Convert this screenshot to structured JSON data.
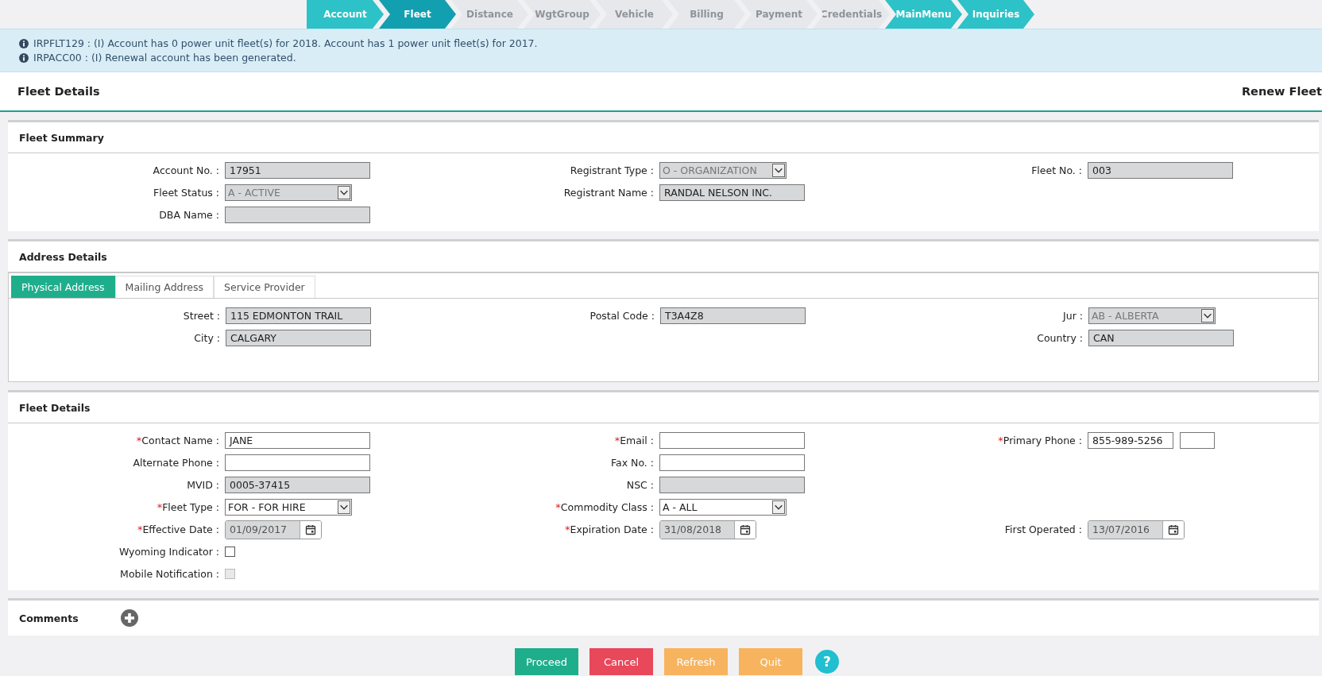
{
  "nav": {
    "steps": [
      {
        "label": "Account",
        "selected": false,
        "enabled": true
      },
      {
        "label": "Fleet",
        "selected": true,
        "enabled": true
      },
      {
        "label": "Distance",
        "selected": false,
        "enabled": false
      },
      {
        "label": "WgtGroup",
        "selected": false,
        "enabled": false
      },
      {
        "label": "Vehicle",
        "selected": false,
        "enabled": false
      },
      {
        "label": "Billing",
        "selected": false,
        "enabled": false
      },
      {
        "label": "Payment",
        "selected": false,
        "enabled": false
      },
      {
        "label": "Credentials",
        "selected": false,
        "enabled": false
      },
      {
        "label": "MainMenu",
        "selected": false,
        "enabled": true
      },
      {
        "label": "Inquiries",
        "selected": false,
        "enabled": true
      }
    ]
  },
  "messages": [
    {
      "text": "IRPFLT129 : (I) Account has 0 power unit fleet(s) for 2018. Account has 1 power unit fleet(s) for 2017."
    },
    {
      "text": "IRPACC00 : (I) Renewal account has been generated."
    }
  ],
  "header": {
    "title": "Fleet Details",
    "action": "Renew Fleet"
  },
  "sections": [
    {
      "kind": "form",
      "title": "Fleet Summary",
      "rows": [
        {
          "left": {
            "label": "Account No. :",
            "kind": "text",
            "value": "17951",
            "readonly": true
          },
          "middle": {
            "label": "Registrant Type :",
            "kind": "select",
            "value": "O - ORGANIZATION",
            "readonly": true
          },
          "right": {
            "label": "Fleet No. :",
            "kind": "text",
            "value": "003",
            "readonly": true
          }
        },
        {
          "left": {
            "label": "Fleet Status :",
            "kind": "select",
            "value": "A - ACTIVE",
            "readonly": true
          },
          "middle": {
            "label": "Registrant Name :",
            "kind": "text",
            "value": "RANDAL NELSON INC.",
            "readonly": true
          }
        },
        {
          "left": {
            "label": "DBA Name :",
            "kind": "text",
            "readonly": true
          }
        }
      ]
    },
    {
      "kind": "form",
      "title": "Address Details",
      "tabs": [
        {
          "label": "Physical Address",
          "selected": true
        },
        {
          "label": "Mailing Address",
          "selected": false
        },
        {
          "label": "Service Provider",
          "selected": false
        }
      ],
      "rows": [
        {
          "left": {
            "label": "Street :",
            "kind": "text",
            "value": "115 EDMONTON TRAIL",
            "readonly": true
          },
          "middle": {
            "label": "Postal Code :",
            "kind": "text",
            "value": "T3A4Z8",
            "readonly": true
          },
          "right": {
            "label": "Jur :",
            "kind": "select",
            "value": "AB - ALBERTA",
            "readonly": true
          }
        },
        {
          "left": {
            "label": "City :",
            "kind": "text",
            "value": "CALGARY",
            "readonly": true
          },
          "right": {
            "label": "Country :",
            "kind": "text",
            "value": "CAN",
            "readonly": true
          }
        }
      ]
    },
    {
      "kind": "form",
      "title": "Fleet Details",
      "rows": [
        {
          "left": {
            "label": "Contact Name :",
            "required_mark": "*",
            "kind": "text",
            "value": "JANE",
            "readonly": false
          },
          "middle": {
            "label": "Email :",
            "required_mark": "*",
            "kind": "text",
            "readonly": false
          },
          "right": {
            "label": "Primary Phone :",
            "required_mark": "*",
            "kind": "phone",
            "value": "855-989-5256",
            "readonly": false
          }
        },
        {
          "left": {
            "label": "Alternate Phone :",
            "kind": "text",
            "readonly": false
          },
          "middle": {
            "label": "Fax No. :",
            "kind": "text",
            "readonly": false
          }
        },
        {
          "left": {
            "label": "MVID :",
            "kind": "text",
            "value": "0005-37415",
            "readonly": true
          },
          "middle": {
            "label": "NSC :",
            "kind": "text",
            "readonly": true
          }
        },
        {
          "left": {
            "label": "Fleet Type :",
            "required_mark": "*",
            "kind": "select",
            "value": "FOR - FOR HIRE",
            "readonly": false
          },
          "middle": {
            "label": "Commodity Class :",
            "required_mark": "*",
            "kind": "select",
            "value": "A - ALL",
            "readonly": false
          }
        },
        {
          "left": {
            "label": "Effective Date :",
            "required_mark": "*",
            "kind": "date",
            "value": "01/09/2017",
            "readonly": true
          },
          "middle": {
            "label": "Expiration Date :",
            "required_mark": "*",
            "kind": "date",
            "value": "31/08/2018",
            "readonly": true
          },
          "right": {
            "label": "First Operated :",
            "kind": "date",
            "value": "13/07/2016",
            "readonly": true
          }
        },
        {
          "left": {
            "label": "Wyoming Indicator :",
            "kind": "checkbox",
            "checked": false,
            "disabled": false
          }
        },
        {
          "left": {
            "label": "Mobile Notification :",
            "kind": "checkbox",
            "checked": false,
            "disabled": true
          }
        }
      ]
    },
    {
      "kind": "comments",
      "title": "Comments"
    }
  ],
  "buttons": [
    {
      "label": "Proceed",
      "kind": "primary"
    },
    {
      "label": "Cancel",
      "kind": "danger"
    },
    {
      "label": "Refresh",
      "kind": "warning"
    },
    {
      "label": "Quit",
      "kind": "warning"
    }
  ],
  "help": {
    "label": "?"
  }
}
